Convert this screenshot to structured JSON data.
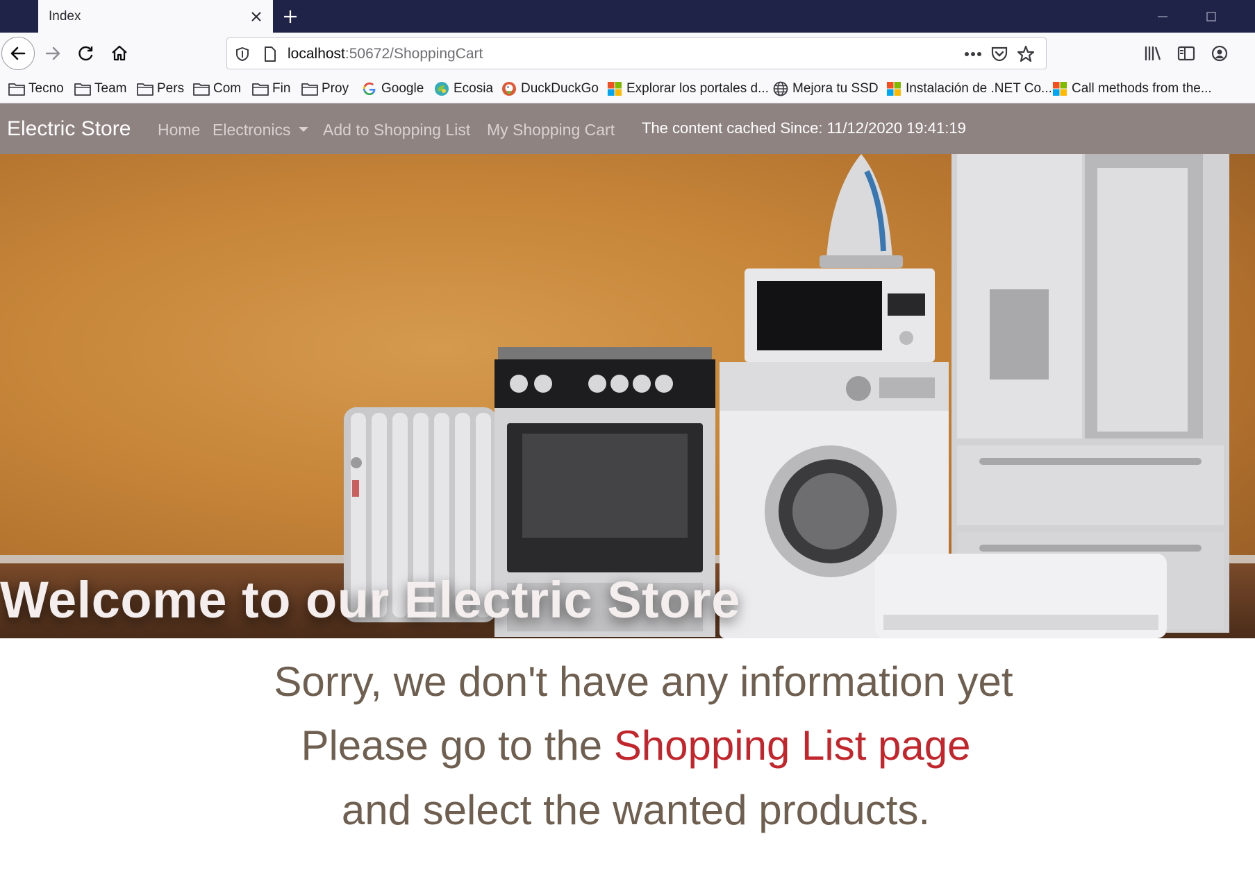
{
  "browser": {
    "tab_title": "Index",
    "url_host": "localhost",
    "url_rest": ":50672/ShoppingCart",
    "bookmarks": [
      {
        "label": "Tecno",
        "icon": "folder-icon"
      },
      {
        "label": "Team",
        "icon": "folder-icon"
      },
      {
        "label": "Pers",
        "icon": "folder-icon"
      },
      {
        "label": "Com",
        "icon": "folder-icon"
      },
      {
        "label": "Fin",
        "icon": "folder-icon"
      },
      {
        "label": "Proy",
        "icon": "folder-icon"
      },
      {
        "label": "Google",
        "icon": "google-icon"
      },
      {
        "label": "Ecosia",
        "icon": "ecosia-icon"
      },
      {
        "label": "DuckDuckGo",
        "icon": "duckduckgo-icon"
      },
      {
        "label": "Explorar los portales d...",
        "icon": "microsoft-icon"
      },
      {
        "label": "Mejora tu SSD",
        "icon": "globe-icon"
      },
      {
        "label": "Instalación de .NET Co...",
        "icon": "microsoft-icon"
      },
      {
        "label": "Call methods from the...",
        "icon": "microsoft-icon"
      }
    ]
  },
  "site_nav": {
    "brand": "Electric Store",
    "links": [
      "Home",
      "Electronics",
      "Add to Shopping List",
      "My Shopping Cart"
    ],
    "cached_text": "The content cached Since: 11/12/2020 19:41:19"
  },
  "hero": {
    "title": "Welcome to our Electric Store"
  },
  "message": {
    "line1": "Sorry, we don't have any information yet",
    "line2_prefix": "Please go to the ",
    "line2_link": "Shopping List page",
    "line3": "and select the wanted products."
  },
  "colors": {
    "titlebar": "#1f2347",
    "site_nav": "#8f8382",
    "message_text": "#6e5f50",
    "link": "#c0262c"
  }
}
